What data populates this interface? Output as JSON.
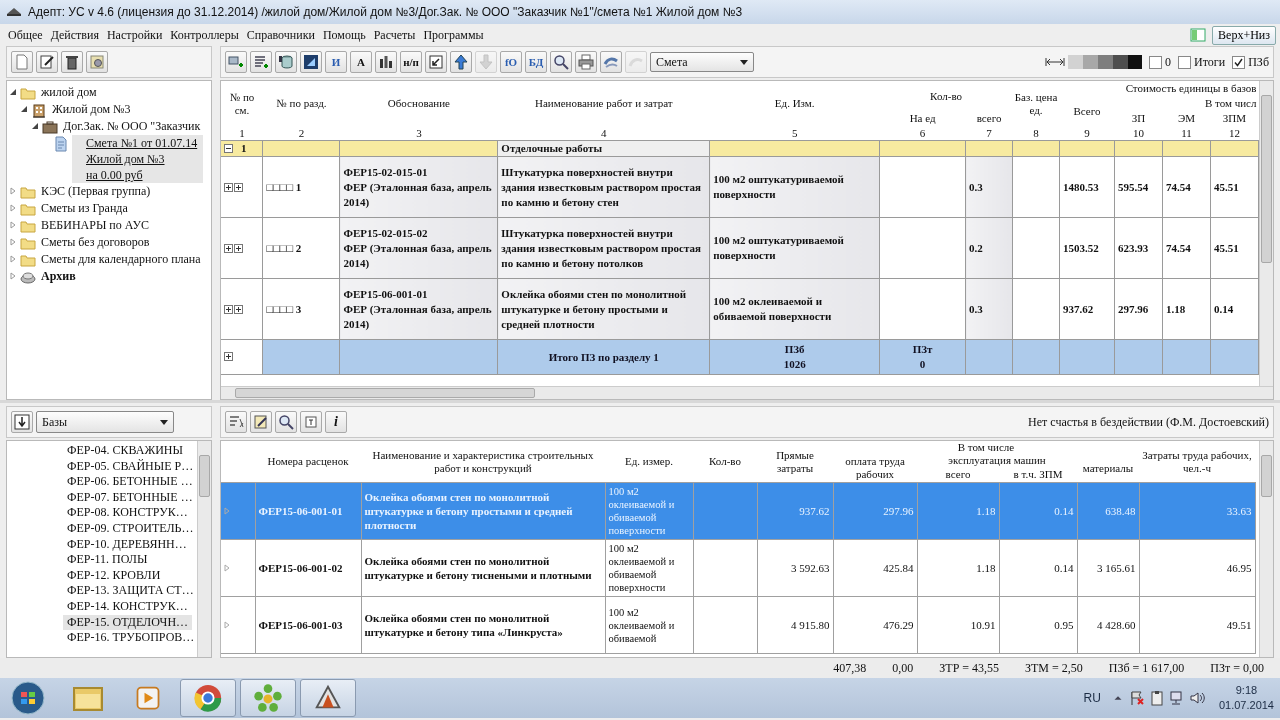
{
  "window": {
    "title": "Адепт: УС  v 4.6 (лицензия до 31.12.2014) /жилой дом/Жилой дом №3/Дог.Зак. № ООО \"Заказчик №1\"/смета №1 Жилой дом №3"
  },
  "menu": [
    "Общее",
    "Действия",
    "Настройки",
    "Контроллеры",
    "Справочники",
    "Помощь",
    "Расчеты",
    "Программы"
  ],
  "view_button": {
    "label": "Верх+Низ"
  },
  "tree": [
    {
      "label": "жилой дом",
      "kind": "folder",
      "expanded": true,
      "selected": false,
      "children": [
        {
          "label": "Жилой дом №3",
          "kind": "building",
          "expanded": true,
          "selected": false,
          "children": [
            {
              "label": "Дог.Зак. № ООО \"Заказчик",
              "kind": "briefcase",
              "expanded": true,
              "selected": false,
              "children": [
                {
                  "lines": [
                    "Смета №1 от 01.07.14",
                    "Жилой дом №3",
                    "на 0.00 руб"
                  ],
                  "kind": "document",
                  "selected": true
                }
              ]
            }
          ]
        }
      ]
    },
    {
      "label": "КЭС (Первая группа)",
      "kind": "folder",
      "expanded": false,
      "selected": false
    },
    {
      "label": "Сметы из Гранда",
      "kind": "folder",
      "expanded": false,
      "selected": false
    },
    {
      "label": "ВЕБИНАРЫ по АУС",
      "kind": "folder",
      "expanded": false,
      "selected": false
    },
    {
      "label": "Сметы без договоров",
      "kind": "folder",
      "expanded": false,
      "selected": false
    },
    {
      "label": "Сметы для календарного плана",
      "kind": "folder",
      "expanded": false,
      "selected": false
    },
    {
      "label": "Архив",
      "kind": "archive",
      "expanded": false,
      "selected": false
    }
  ],
  "toolbar": [
    {
      "kind": "icon",
      "disabled": false
    },
    {
      "kind": "icon",
      "disabled": false
    },
    {
      "kind": "icon",
      "disabled": false
    },
    {
      "kind": "icon",
      "disabled": false
    },
    {
      "kind": "text",
      "label": "И",
      "disabled": false
    },
    {
      "kind": "text",
      "label": "А",
      "disabled": false
    },
    {
      "kind": "icon",
      "disabled": false
    },
    {
      "kind": "text",
      "label": "н/п",
      "disabled": false
    },
    {
      "kind": "icon",
      "disabled": false
    },
    {
      "kind": "icon",
      "disabled": false
    },
    {
      "kind": "icon",
      "disabled": true
    },
    {
      "kind": "text",
      "label": "fO",
      "disabled": false
    },
    {
      "kind": "text",
      "label": "БД",
      "disabled": false
    },
    {
      "kind": "icon",
      "disabled": false
    },
    {
      "kind": "icon",
      "disabled": false
    },
    {
      "kind": "icon",
      "disabled": false
    },
    {
      "kind": "icon",
      "disabled": true
    }
  ],
  "mode_select": {
    "value": "Смета"
  },
  "options": [
    {
      "label": "0",
      "checked": false
    },
    {
      "label": "Итоги",
      "checked": false
    },
    {
      "label": "ПЗб",
      "checked": true
    }
  ],
  "estimate_table": {
    "header": {
      "number": "№ по см.",
      "section_number": "№ по разд.",
      "basis": "Обоснование",
      "name": "Наименование работ и затрат",
      "unit": "Ед. Изм.",
      "quantity": "Кол-во",
      "per_unit": "На ед",
      "qty_total": "всего",
      "base_price": "Баз. цена ед.",
      "unit_cost": "Стоимость единицы в базов",
      "total": "Всего",
      "including": "В том числ",
      "zp": "ЗП",
      "em": "ЭМ",
      "zpm": "ЗПМ"
    },
    "column_numbers": [
      "1",
      "2",
      "3",
      "4",
      "5",
      "6",
      "7",
      "8",
      "9",
      "10",
      "11",
      "12"
    ],
    "rows": [
      {
        "kind": "section",
        "number": "1",
        "title": "Отделочные работы",
        "expanded": true
      },
      {
        "kind": "item",
        "number": "□□□□ 1",
        "code": "ФЕР15-02-015-01",
        "base": "ФЕР (Эталонная база, апрель 2014)",
        "name": "Штукатурка поверхностей внутри здания известковым раствором простая по камню и бетону стен",
        "unit": "100 м2 оштукатуриваемой поверхности",
        "qty_total": "0.3",
        "total": "1480.53",
        "zp": "595.54",
        "em": "74.54",
        "zpm": "45.51"
      },
      {
        "kind": "item",
        "number": "□□□□ 2",
        "code": "ФЕР15-02-015-02",
        "base": "ФЕР (Эталонная база, апрель 2014)",
        "name": "Штукатурка поверхностей внутри здания известковым раствором простая по камню и бетону потолков",
        "unit": "100 м2 оштукатуриваемой поверхности",
        "qty_total": "0.2",
        "total": "1503.52",
        "zp": "623.93",
        "em": "74.54",
        "zpm": "45.51"
      },
      {
        "kind": "item",
        "number": "□□□□ 3",
        "code": "ФЕР15-06-001-01",
        "base": "ФЕР (Эталонная база, апрель 2014)",
        "name": "Оклейка обоями стен по монолитной штукатурке и бетону простыми и средней плотности",
        "unit": "100 м2 оклеиваемой и обиваемой поверхности",
        "qty_total": "0.3",
        "total": "937.62",
        "zp": "297.96",
        "em": "1.18",
        "zpm": "0.14"
      },
      {
        "kind": "total",
        "title": "Итого ПЗ по разделу 1",
        "pzb_label": "ПЗб",
        "pzb": "1026",
        "pzt_label": "ПЗт",
        "pzt": "0"
      }
    ]
  },
  "bases_panel": {
    "combo": "Базы",
    "items": [
      {
        "label": "ФЕР-04. СКВАЖИНЫ",
        "selected": false
      },
      {
        "label": "ФЕР-05. СВАЙНЫЕ Р…",
        "selected": false
      },
      {
        "label": "ФЕР-06. БЕТОННЫЕ …",
        "selected": false
      },
      {
        "label": "ФЕР-07. БЕТОННЫЕ …",
        "selected": false
      },
      {
        "label": "ФЕР-08. КОНСТРУК…",
        "selected": false
      },
      {
        "label": "ФЕР-09. СТРОИТЕЛЬ…",
        "selected": false
      },
      {
        "label": "ФЕР-10. ДЕРЕВЯНН…",
        "selected": false
      },
      {
        "label": "ФЕР-11. ПОЛЫ",
        "selected": false
      },
      {
        "label": "ФЕР-12. КРОВЛИ",
        "selected": false
      },
      {
        "label": "ФЕР-13. ЗАЩИТА СТ…",
        "selected": false
      },
      {
        "label": "ФЕР-14. КОНСТРУК…",
        "selected": false
      },
      {
        "label": "ФЕР-15. ОТДЕЛОЧН…",
        "selected": true
      },
      {
        "label": "ФЕР-16. ТРУБОПРОВ…",
        "selected": false
      }
    ]
  },
  "bottom_toolbar": [
    {
      "kind": "icon"
    },
    {
      "kind": "icon"
    },
    {
      "kind": "icon"
    },
    {
      "kind": "icon"
    },
    {
      "kind": "text",
      "label": "i"
    }
  ],
  "quote": "Нет счастья в бездействии (Ф.М. Достоевский)",
  "rates_table": {
    "header": {
      "code": "Номера расценок",
      "name": "Наименование и характеристика строительных работ и конструкций",
      "unit": "Ед. измер.",
      "qty": "Кол-во",
      "direct": "Прямые затраты",
      "including": "В том числе",
      "labor": "оплата труда рабочих",
      "machines": "эксплуатация машин",
      "machines_total": "всего",
      "machines_zpm": "в т.ч. ЗПМ",
      "materials": "материалы",
      "hours": "Затраты труда рабочих, чел.-ч"
    },
    "rows": [
      {
        "selected": true,
        "code": "ФЕР15-06-001-01",
        "name": "Оклейка обоями стен по монолитной штукатурке и бетону простыми и средней плотности",
        "unit": "100 м2 оклеиваемой и обиваемой поверхности",
        "direct": "937.62",
        "labor": "297.96",
        "machines_total": "1.18",
        "machines_zpm": "0.14",
        "materials": "638.48",
        "hours": "33.63"
      },
      {
        "selected": false,
        "code": "ФЕР15-06-001-02",
        "name": "Оклейка обоями стен по монолитной штукатурке и бетону тиснеными и плотными",
        "unit": "100 м2 оклеиваемой и обиваемой поверхности",
        "direct": "3 592.63",
        "labor": "425.84",
        "machines_total": "1.18",
        "machines_zpm": "0.14",
        "materials": "3 165.61",
        "hours": "46.95"
      },
      {
        "selected": false,
        "code": "ФЕР15-06-001-03",
        "name": "Оклейка обоями стен по монолитной штукатурке и бетону типа «Линкруста»",
        "unit": "100 м2 оклеиваемой и обиваемой",
        "direct": "4 915.80",
        "labor": "476.29",
        "machines_total": "10.91",
        "machines_zpm": "0.95",
        "materials": "4 428.60",
        "hours": "49.51"
      }
    ]
  },
  "totals": [
    "407,38",
    "0,00",
    "ЗТР = 43,55",
    "ЗТМ = 2,50",
    "ПЗб = 1 617,00",
    "ПЗт = 0,00"
  ],
  "taskbar": {
    "apps": [
      {
        "running": false
      },
      {
        "running": false
      },
      {
        "running": true
      },
      {
        "running": true
      },
      {
        "running": true
      }
    ],
    "language": "RU",
    "time": "9:18",
    "date": "01.07.2014"
  }
}
